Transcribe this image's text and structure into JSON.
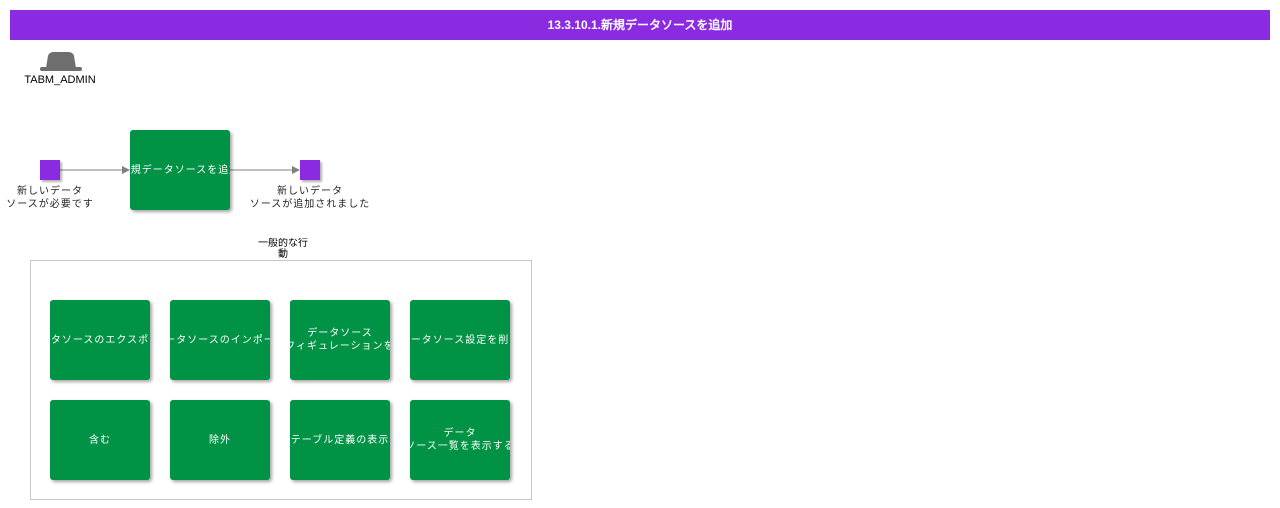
{
  "title": "13.3.10.1.新規データソースを追加",
  "role": {
    "label": "TABM_ADMIN",
    "icon": "hat-icon"
  },
  "flow": {
    "start_event": {
      "label_line1": "新しいデータ",
      "label_line2": "ソースが必要です"
    },
    "process": {
      "label": "新規データソースを追加"
    },
    "end_event": {
      "label_line1": "新しいデータ",
      "label_line2": "ソースが追加されました"
    }
  },
  "group": {
    "label_line1": "一般的な行",
    "label_line2": "動",
    "actions": [
      {
        "line1": "データソースのエクスポート",
        "line2": ""
      },
      {
        "line1": "データソースのインポート",
        "line2": ""
      },
      {
        "line1": "データソース",
        "line2": "コンフィギュレーションを作成"
      },
      {
        "line1": "データソース設定を削除",
        "line2": ""
      },
      {
        "line1": "含む",
        "line2": ""
      },
      {
        "line1": "除外",
        "line2": ""
      },
      {
        "line1": "テーブル定義の表示",
        "line2": ""
      },
      {
        "line1": "データ",
        "line2": "ソース一覧を表示する"
      }
    ]
  },
  "colors": {
    "title_bar": "#8a2be2",
    "event": "#8a2be2",
    "activity": "#009245",
    "connector": "#808080"
  }
}
